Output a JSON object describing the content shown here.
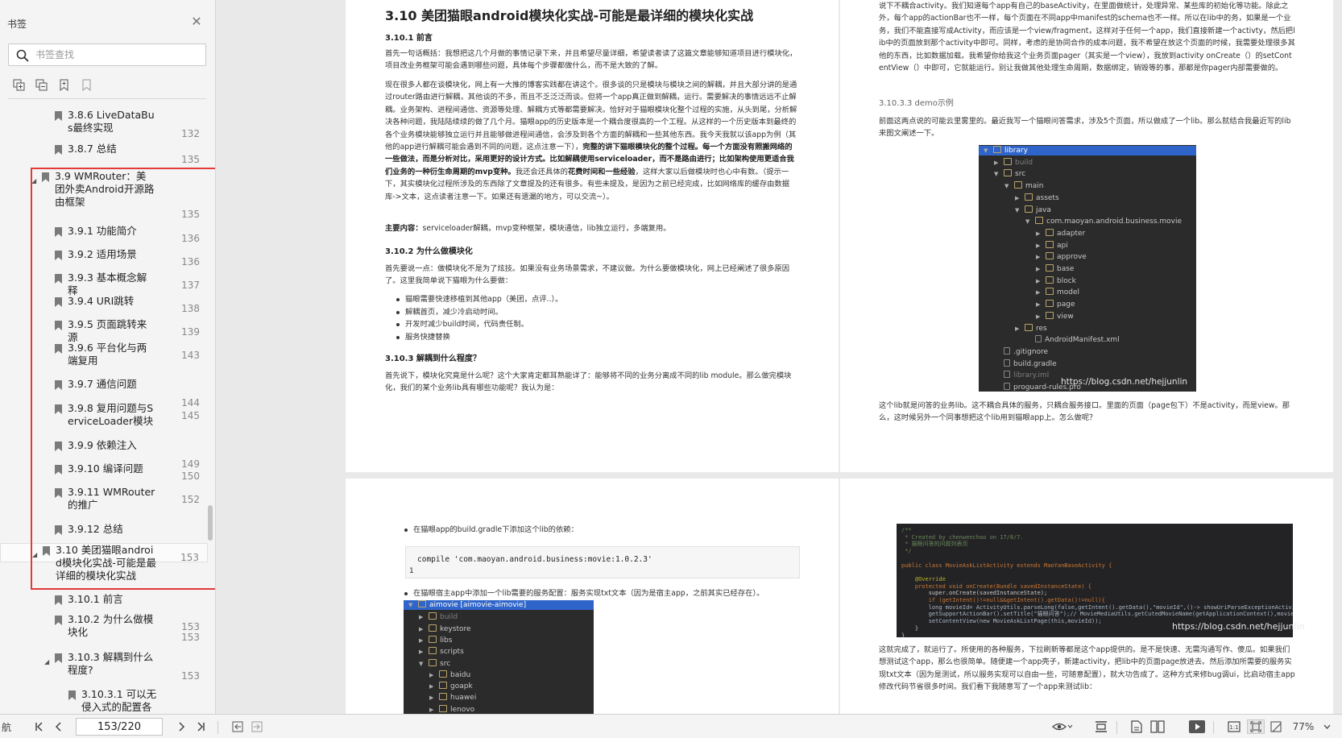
{
  "sidebar": {
    "title": "书签",
    "search_placeholder": "书签查找",
    "tool_icons": [
      "expand-all-icon",
      "collapse-all-icon",
      "add-bookmark-icon",
      "bookmark-outline-icon"
    ],
    "items": [
      {
        "label": "3.8.6 LiveDataBus最终实现",
        "page": "132",
        "level": 2
      },
      {
        "label": "3.8.7 总结",
        "page": "135",
        "level": 2
      },
      {
        "label": "3.9 WMRouter：美团外卖Android开源路由框架",
        "page": "135",
        "level": 1,
        "expanded": true
      },
      {
        "label": "3.9.1 功能简介",
        "page": "136",
        "level": 2
      },
      {
        "label": "3.9.2 适用场景",
        "page": "136",
        "level": 2
      },
      {
        "label": "3.9.3 基本概念解释",
        "page": "137",
        "level": 2
      },
      {
        "label": "3.9.4 URI跳转",
        "page": "138",
        "level": 2
      },
      {
        "label": "3.9.5 页面跳转来源",
        "page": "139",
        "level": 2
      },
      {
        "label": "3.9.6 平台化与两端复用",
        "page": "143",
        "level": 2
      },
      {
        "label": "3.9.7 通信问题",
        "page": "144",
        "level": 2
      },
      {
        "label": "3.9.8 复用问题与ServiceLoader模块",
        "page": "145",
        "level": 2
      },
      {
        "label": "3.9.9 依赖注入",
        "page": "149",
        "level": 2
      },
      {
        "label": "3.9.10 编译问题",
        "page": "150",
        "level": 2
      },
      {
        "label": "3.9.11 WMRouter的推广",
        "page": "152",
        "level": 2
      },
      {
        "label": "3.9.12 总结",
        "page": "152",
        "level": 2
      },
      {
        "label": "3.10 美团猫眼android模块化实战-可能是最详细的模块化实战",
        "page": "153",
        "level": 1,
        "expanded": true,
        "selected": true
      },
      {
        "label": "3.10.1 前言",
        "page": "153",
        "level": 2
      },
      {
        "label": "3.10.2 为什么做模块化",
        "page": "153",
        "level": 2
      },
      {
        "label": "3.10.3 解耦到什么程度?",
        "page": "153",
        "level": 2,
        "expanded": true
      },
      {
        "label": "3.10.3.1 可以无侵入式的配置各",
        "page": "",
        "level": 3
      }
    ]
  },
  "page1": {
    "title": "3.10 美团猫眼android模块化实战-可能是最详细的模块化实战",
    "s1_heading": "3.10.1 前言",
    "p1": "首先一句话概括：我想把这几个月做的事情记录下来，并且希望尽量详细，希望读者读了这篇文章能够知道项目进行模块化，项目改业务框架可能会遇到哪些问题，具体每个步骤都做什么，而不是大致的了解。",
    "p2a": "现在很多人都在谈模块化，网上有一大推的博客实践都在讲这个。很多谈的只是模块与模块之间的解耦，并且大部分讲的是通过router路由进行解耦，其他谈的不多，而且不乏泛泛而谈。但将一个app真正做到解耦，运行。需要解决的事情远远不止解耦。业务架构、进程间通信、资源等处理、解耦方式等都需要解决。恰好对于猫眼模块化整个过程的实施，从头到尾，分析解决各种问题，我陆陆续续的做了几个月。猫眼app的历史版本是一个耦合度很高的一个工程。从这样的一个历史版本到最终的各个业务模块能够独立运行并且能够做进程间通信，会涉及到各个方面的解耦和一些其他东西。我今天我就以该app为例（其他的app进行解耦可能会遇到不同的问题，这点注意一下），",
    "p2b": "完整的讲下猫眼模块化的整个过程。每一个方面没有照搬网络的一些做法，而是分析对比，采用更好的设计方式。比如解耦使用serviceloader，而不是路由进行；比如架构使用更适合我们业务的一种衍生命周期的mvp变种。",
    "p2c": "我还会还具体的",
    "p2d": "花费时间和一些经验",
    "p2e": "，这样大家以后做模块时也心中有数。（提示一下，其实模块化过程所涉及的东西除了文章提及的还有很多。有些未提及，是因为之前已经完成，比如网络库的缓存由数据库->文本，这点读者注意一下。如果还有遗漏的地方，可以交流~）。",
    "p3_label": "主要内容：",
    "p3": "serviceloader解耦，mvp变种框架，模块通信，lib独立运行，多端复用。",
    "s2_heading": "3.10.2 为什么做模块化",
    "p4": "首先要说一点：做模块化不是为了炫技。如果没有业务场景需求，不建议做。为什么要做模块化，网上已经阐述了很多原因了。这里我简单说下猫眼为什么要做：",
    "bullets": [
      "猫眼需要快速移植到其他app（美团，点评..）。",
      "解耦首页，减少冷启动时间。",
      "开发时减少build时间，代码责任制。",
      "服务快捷替换"
    ],
    "s3_heading": "3.10.3 解耦到什么程度？",
    "p5": "首先说下，模块化究竟是什么呢？这个大家肯定都耳熟能详了：能够将不同的业务分离成不同的lib module。那么做完模块化，我们的某个业务lib具有哪些功能呢？我认为是："
  },
  "page2": {
    "p1": "说下不耦合activity。我们知道每个app有自己的baseActivity，在里面做统计，处理异常、某些库的初始化等功能。除此之外，每个app的actionBar也不一样，每个页面在不同app中manifest的schema也不一样。所以在lib中的务，如果是一个业务，我们不能直接写成Activity，而应该是一个view/fragment，这样对于任何一个app，我们直接新建一个activty，然后把lib中的页面放到那个activity中即可。同样，考虑的是协同合作的成本问题，我不希望在放这个页面的时候，我需要处理很多其他的东西，比如数据加载。我希望你给我这个业务页面pager（其实是一个view），我放到activity onCreate（）的setContentView（）中即可，它就能运行。别让我做其他处理生命周期，数据绑定，销毁等的事，那都是你pager内部需要做的。",
    "demo_heading": "3.10.3.3 demo示例",
    "p2": "前面这两点说的可能云里雾里的。最近我写一个猫眼问答需求，涉及5个页面，所以做成了一个lib。那么就结合我最近写的lib来图文阐述一下。",
    "tree": [
      "library",
      "build",
      "src",
      "main",
      "assets",
      "java",
      "com.maoyan.android.business.movie",
      "adapter",
      "api",
      "approve",
      "base",
      "block",
      "model",
      "page",
      "view",
      "res",
      "AndroidManifest.xml",
      ".gitignore",
      "build.gradle",
      "library.iml",
      "proguard-rules.pro"
    ],
    "watermark": "https://blog.csdn.net/hejjunlin",
    "p3": "这个lib就是问答的业务lib。这不耦合具体的服务，只耦合服务接口。里面的页面（page包下）不是activity，而是view。那么，这时候另外一个同事想把这个lib用到猫眼app上。怎么做呢？"
  },
  "page3": {
    "bullet1": "在猫眼app的build.gradle下添加这个lib的依赖：",
    "code_line": "compile 'com.maoyan.android.business:movie:1.0.2.3'",
    "code_num": "1",
    "bullet2": "在猫眼宿主app中添加一个lib需要的服务配置：服务实现txt文本（因为是宿主app，之前其实已经存在）。",
    "tree_title": "aimovie [aimovie-aimovie]",
    "tree": [
      "build",
      "keystore",
      "libs",
      "scripts",
      "src",
      "baidu",
      "goapk",
      "huawei",
      "lenovo"
    ]
  },
  "page4": {
    "code_lines": [
      "/**",
      " * Created by chenwenchao on 17/8/7.",
      " * 猫眼问答的问题列表页",
      " */",
      "",
      "public class MovieAskListActivity extends MaoYanBaseActivity {",
      "",
      "    @Override",
      "    protected void onCreate(Bundle savedInstanceState) {",
      "        super.onCreate(savedInstanceState);",
      "        if (getIntent()!=null&&getIntent().getData()!=null){",
      "        long movieId= ActivityUtils.parseLong(false,getIntent().getData(),\"movieId\",()-> showUriParseExceptionActivity());",
      "        getSupportActionBar().setTitle(\"猫眼问答\");// MovieMediaUtils.getCutedMovieName(getApplicationContext(),movieId));",
      "        setContentView(new MovieAskListPage(this,movieId));",
      "    }",
      "}"
    ],
    "watermark": "https://blog.csdn.net/hejjunlin",
    "p1": "这就完成了，就运行了。所使用的各种服务，下拉刷新等都是这个app提供的。是不是快速、无需沟通写作、傻瓜。如果我们想测试这个app，那么也很简单。随便建一个app壳子，新建activity，把lib中的页面page放进去。然后添加所需要的服务实现txt文本（因为是测试，所以服务实现可以自由一些，可随意配置），就大功告成了。这种方式来修bug调ui，比启动宿主app修改代码节省很多时间。我们看下我随意写了一个app来测试lib："
  },
  "bottombar": {
    "left_label": "航",
    "page_value": "153/220",
    "zoom": "77%"
  },
  "colors": {
    "highlight": "#e23a3a",
    "tree_bg": "#2b2b2b",
    "tree_selected": "#2f65ca"
  }
}
